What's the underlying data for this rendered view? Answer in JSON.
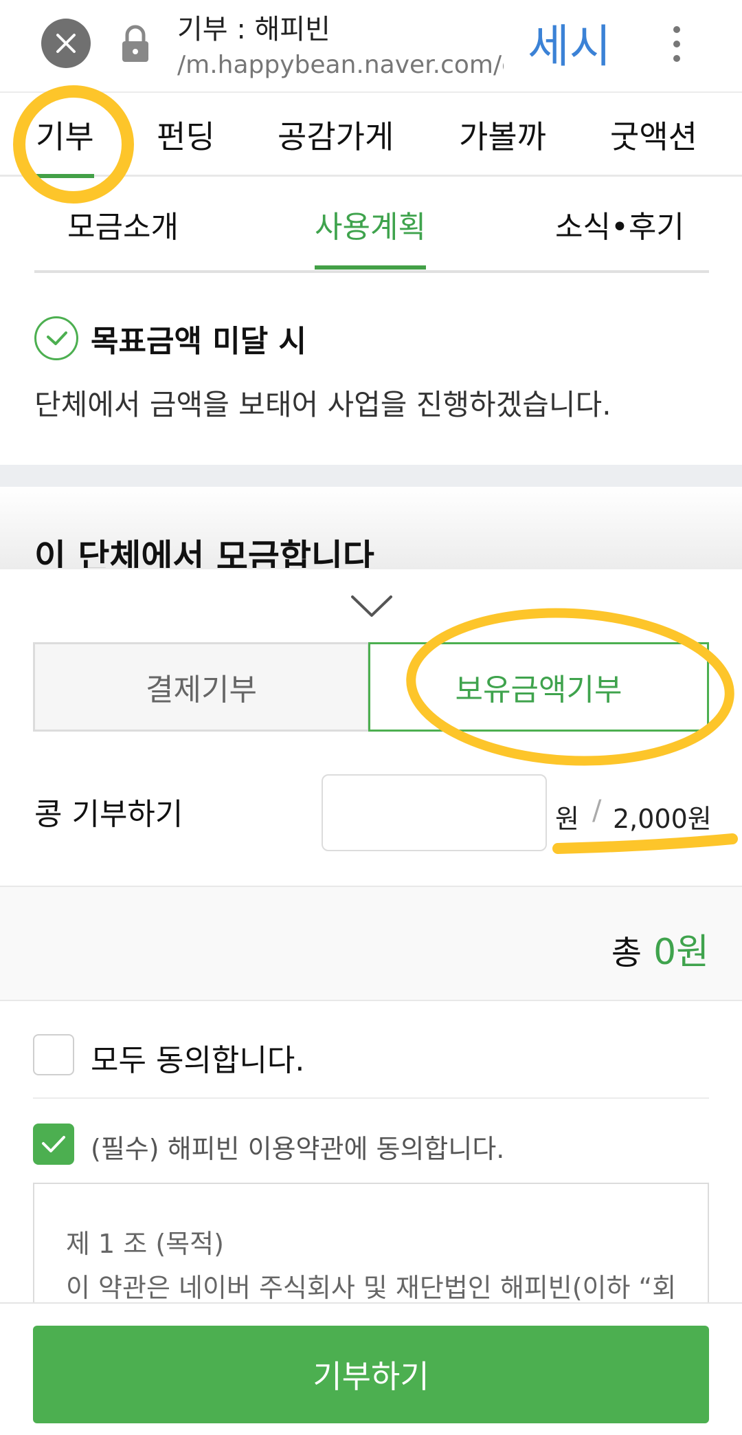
{
  "browser": {
    "page_title": "기부 : 해피빈",
    "url": "/m.happybean.naver.com/c",
    "corner_note": "세시"
  },
  "main_nav": {
    "tabs": [
      "기부",
      "펀딩",
      "공감가게",
      "가볼까",
      "굿액션"
    ],
    "active": "기부"
  },
  "sub_nav": {
    "tabs": [
      "모금소개",
      "사용계획",
      "소식•후기"
    ],
    "active": "사용계획"
  },
  "goal_info": {
    "title": "목표금액 미달 시",
    "description": "단체에서 금액을 보태어 사업을 진행하겠습니다."
  },
  "org_heading": "이 단체에서 모금합니다",
  "donation_type": {
    "options": [
      "결제기부",
      "보유금액기부"
    ],
    "selected": "보유금액기부"
  },
  "bean_donation": {
    "label": "콩 기부하기",
    "input_value": "",
    "unit": "원",
    "separator": "/",
    "balance": "2,000원"
  },
  "total": {
    "label": "총",
    "value": "0원"
  },
  "agreements": {
    "all_label": "모두 동의합니다.",
    "all_checked": false,
    "terms_label": "(필수) 해피빈 이용약관에 동의합니다.",
    "terms_checked": true,
    "terms_title": "제 1 조 (목적)",
    "terms_excerpt": "이 약관은 네이버 주식회사 및 재단법인 해피빈(이하 “회"
  },
  "donate_button": "기부하기",
  "colors": {
    "accent_green": "#4caf50",
    "highlight_yellow": "#fdc52a",
    "note_blue": "#3b82d6"
  }
}
